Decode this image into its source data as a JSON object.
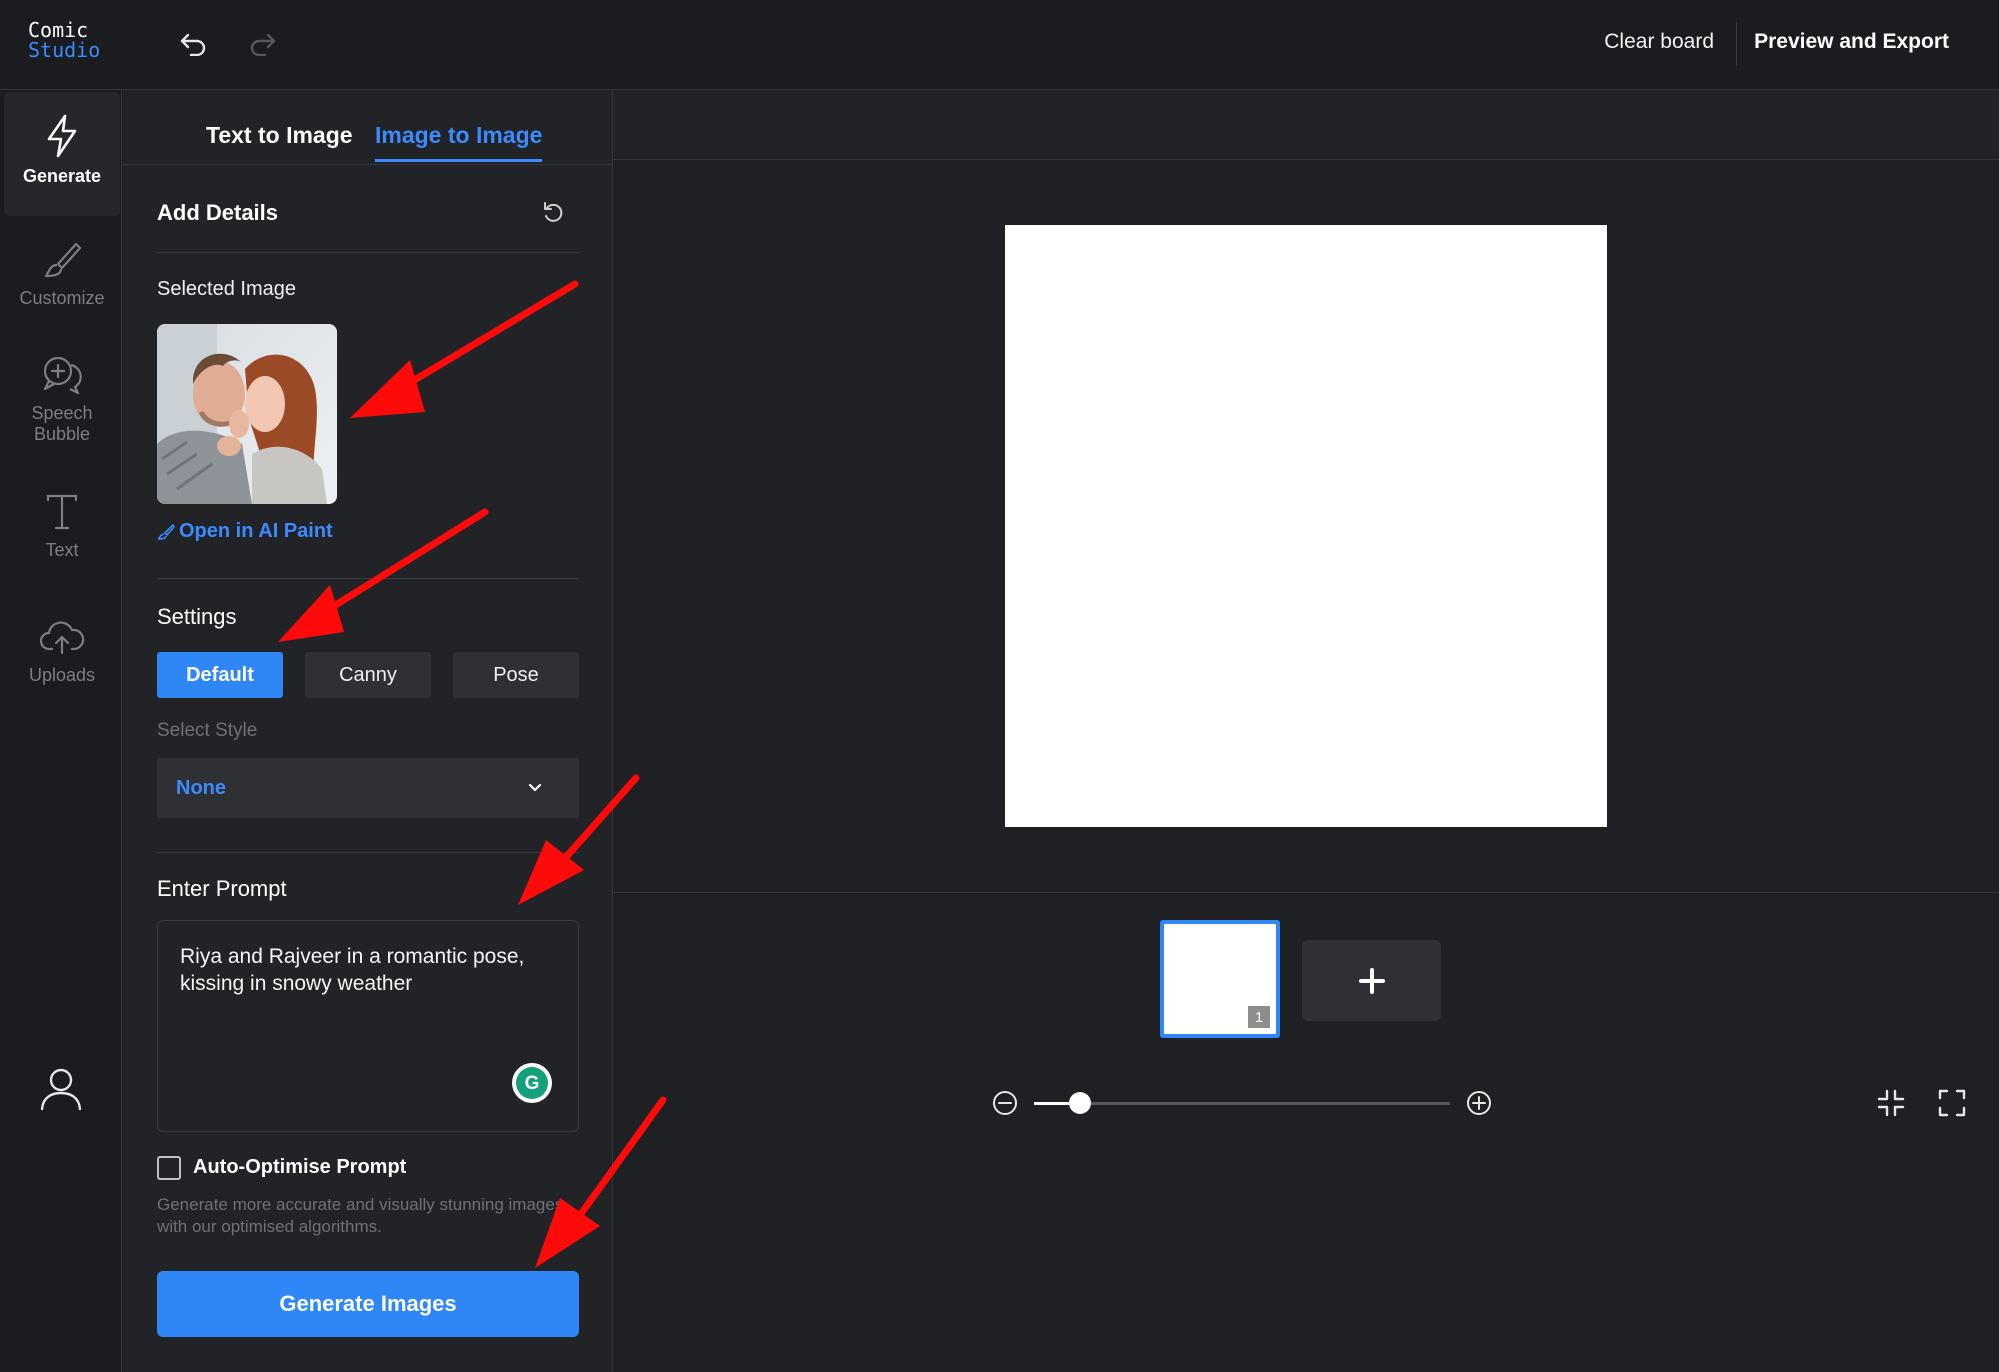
{
  "app": {
    "logo_line1": "Comic",
    "logo_line2": "Studio"
  },
  "header": {
    "clear_board": "Clear board",
    "preview_export": "Preview and Export"
  },
  "rail": {
    "items": [
      {
        "label": "Generate",
        "icon": "lightning-icon"
      },
      {
        "label": "Customize",
        "icon": "brush-icon"
      },
      {
        "label": "Speech Bubble",
        "icon": "speech-bubble-add-icon"
      },
      {
        "label": "Text",
        "icon": "text-t-icon"
      },
      {
        "label": "Uploads",
        "icon": "cloud-upload-icon"
      }
    ],
    "profile_icon": "user-icon"
  },
  "panel": {
    "tabs": [
      {
        "label": "Text to Image"
      },
      {
        "label": "Image to Image"
      }
    ],
    "add_details": "Add Details",
    "selected_image": "Selected Image",
    "open_ai_paint": "Open in AI Paint",
    "settings": "Settings",
    "modes": [
      {
        "label": "Default"
      },
      {
        "label": "Canny"
      },
      {
        "label": "Pose"
      }
    ],
    "select_style_label": "Select Style",
    "style_value": "None",
    "enter_prompt": "Enter Prompt",
    "prompt_value": "Riya and Rajveer in a romantic pose, kissing in snowy weather",
    "grammarly_letter": "G",
    "auto_optimise": "Auto-Optimise Prompt",
    "helper_text": "Generate more accurate and visually stunning images with our optimised algorithms.",
    "generate_button": "Generate Images"
  },
  "pages": {
    "current_page_number": "1",
    "add_page": "+"
  },
  "zoom": {
    "level": 0.11
  },
  "colors": {
    "accent": "#2f86f6",
    "link": "#3b8bff",
    "annotation_arrow": "#ff0a0a",
    "grammarly": "#15a07c"
  }
}
